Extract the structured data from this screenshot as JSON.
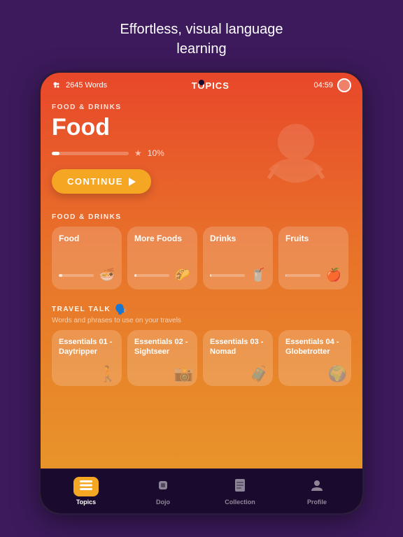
{
  "page": {
    "title_line1": "Effortless, visual language",
    "title_line2": "learning"
  },
  "status_bar": {
    "words_count": "2645 Words",
    "screen_title": "TOPICS",
    "timer": "04:59"
  },
  "hero": {
    "category": "FOOD & DRINKS",
    "title": "Food",
    "progress_pct": "10%",
    "continue_label": "CONTINUE"
  },
  "food_drinks_section": {
    "label": "FOOD & DRINKS",
    "cards": [
      {
        "title": "Food",
        "icon": "🍜",
        "progress": 10
      },
      {
        "title": "More Foods",
        "icon": "🌮",
        "progress": 5
      },
      {
        "title": "Drinks",
        "icon": "🥤",
        "progress": 3
      },
      {
        "title": "Fruits",
        "icon": "🍎",
        "progress": 2
      }
    ]
  },
  "travel_section": {
    "label": "TRAVEL TALK",
    "icon": "🗣️",
    "subtitle": "Words and phrases to use on your travels",
    "cards": [
      {
        "title": "Essentials 01 - Daytripper"
      },
      {
        "title": "Essentials 02 - Sightseer"
      },
      {
        "title": "Essentials 03 - Nomad"
      },
      {
        "title": "Essentials 04 - Globetrotter"
      }
    ]
  },
  "bottom_nav": {
    "items": [
      {
        "label": "Topics",
        "icon": "☰",
        "active": true
      },
      {
        "label": "Dojo",
        "icon": "🥋",
        "active": false
      },
      {
        "label": "Collection",
        "icon": "📋",
        "active": false
      },
      {
        "label": "Profile",
        "icon": "👤",
        "active": false
      }
    ]
  }
}
